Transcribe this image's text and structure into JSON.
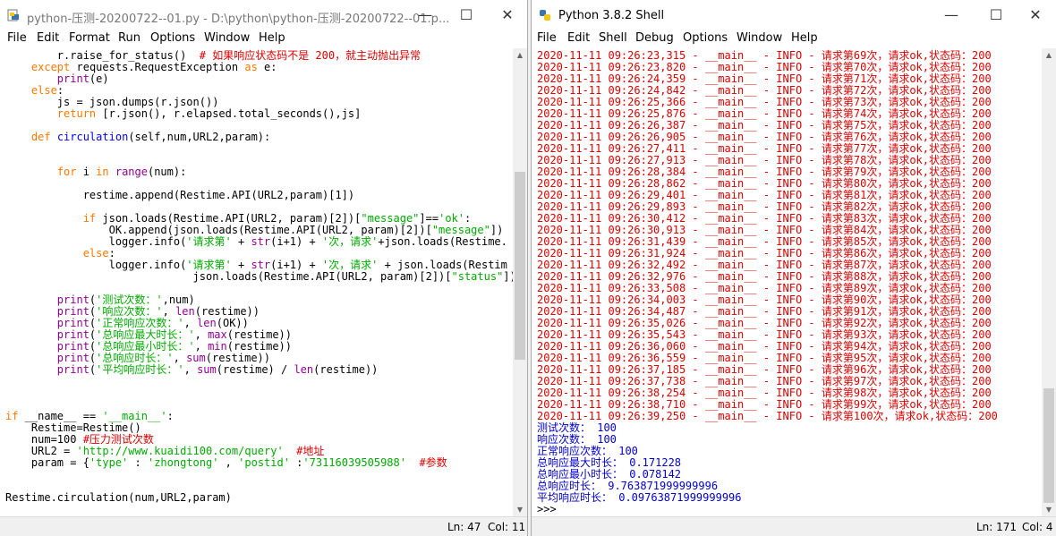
{
  "editor_window": {
    "title": "python-压测-20200722--01.py - D:\\python\\python-压测-20200722--01.p...",
    "menu": [
      "File",
      "Edit",
      "Format",
      "Run",
      "Options",
      "Window",
      "Help"
    ],
    "status": {
      "ln": "Ln: 47",
      "col": "Col: 11"
    },
    "code": [
      [
        {
          "t": "        r.raise_for_status()  ",
          "c": ""
        },
        {
          "t": "# 如果响应状态码不是 200，就主动抛出异常",
          "c": "cmt"
        }
      ],
      [
        {
          "t": "    ",
          "c": ""
        },
        {
          "t": "except",
          "c": "kw"
        },
        {
          "t": " requests.RequestException ",
          "c": ""
        },
        {
          "t": "as",
          "c": "kw"
        },
        {
          "t": " e:",
          "c": ""
        }
      ],
      [
        {
          "t": "        ",
          "c": ""
        },
        {
          "t": "print",
          "c": "bi"
        },
        {
          "t": "(e)",
          "c": ""
        }
      ],
      [
        {
          "t": "    ",
          "c": ""
        },
        {
          "t": "else",
          "c": "kw"
        },
        {
          "t": ":",
          "c": ""
        }
      ],
      [
        {
          "t": "        js = json.dumps(r.json())",
          "c": ""
        }
      ],
      [
        {
          "t": "        ",
          "c": ""
        },
        {
          "t": "return",
          "c": "kw"
        },
        {
          "t": " [r.json(), r.elapsed.total_seconds(),js]",
          "c": ""
        }
      ],
      [
        {
          "t": "",
          "c": ""
        }
      ],
      [
        {
          "t": "    ",
          "c": ""
        },
        {
          "t": "def",
          "c": "kw"
        },
        {
          "t": " ",
          "c": ""
        },
        {
          "t": "circulation",
          "c": "def"
        },
        {
          "t": "(self,num,URL2,param):",
          "c": ""
        }
      ],
      [
        {
          "t": "",
          "c": ""
        }
      ],
      [
        {
          "t": "",
          "c": ""
        }
      ],
      [
        {
          "t": "        ",
          "c": ""
        },
        {
          "t": "for",
          "c": "kw"
        },
        {
          "t": " i ",
          "c": ""
        },
        {
          "t": "in",
          "c": "kw"
        },
        {
          "t": " ",
          "c": ""
        },
        {
          "t": "range",
          "c": "bi"
        },
        {
          "t": "(num):",
          "c": ""
        }
      ],
      [
        {
          "t": "",
          "c": ""
        }
      ],
      [
        {
          "t": "            restime.append(Restime.API(URL2,param)[1])",
          "c": ""
        }
      ],
      [
        {
          "t": "",
          "c": ""
        }
      ],
      [
        {
          "t": "            ",
          "c": ""
        },
        {
          "t": "if",
          "c": "kw"
        },
        {
          "t": " json.loads(Restime.API(URL2, param)[2])[",
          "c": ""
        },
        {
          "t": "\"message\"",
          "c": "str"
        },
        {
          "t": "]==",
          "c": ""
        },
        {
          "t": "'ok'",
          "c": "str"
        },
        {
          "t": ":",
          "c": ""
        }
      ],
      [
        {
          "t": "                OK.append(json.loads(Restime.API(URL2, param)[2])[",
          "c": ""
        },
        {
          "t": "\"message\"",
          "c": "str"
        },
        {
          "t": "])",
          "c": ""
        }
      ],
      [
        {
          "t": "                logger.info(",
          "c": ""
        },
        {
          "t": "'请求第'",
          "c": "str"
        },
        {
          "t": " + ",
          "c": ""
        },
        {
          "t": "str",
          "c": "bi"
        },
        {
          "t": "(i+1) + ",
          "c": ""
        },
        {
          "t": "'次，请求'",
          "c": "str"
        },
        {
          "t": "+json.loads(Restime.",
          "c": ""
        }
      ],
      [
        {
          "t": "            ",
          "c": ""
        },
        {
          "t": "else",
          "c": "kw"
        },
        {
          "t": ":",
          "c": ""
        }
      ],
      [
        {
          "t": "                logger.info(",
          "c": ""
        },
        {
          "t": "'请求第'",
          "c": "str"
        },
        {
          "t": " + ",
          "c": ""
        },
        {
          "t": "str",
          "c": "bi"
        },
        {
          "t": "(i+1) + ",
          "c": ""
        },
        {
          "t": "'次，请求'",
          "c": "str"
        },
        {
          "t": " + json.loads(Restim",
          "c": ""
        }
      ],
      [
        {
          "t": "                             json.loads(Restime.API(URL2, param)[2])[",
          "c": ""
        },
        {
          "t": "\"status\"",
          "c": "str"
        },
        {
          "t": "])",
          "c": ""
        }
      ],
      [
        {
          "t": "",
          "c": ""
        }
      ],
      [
        {
          "t": "        ",
          "c": ""
        },
        {
          "t": "print",
          "c": "bi"
        },
        {
          "t": "(",
          "c": ""
        },
        {
          "t": "'测试次数：'",
          "c": "str"
        },
        {
          "t": ",num)",
          "c": ""
        }
      ],
      [
        {
          "t": "        ",
          "c": ""
        },
        {
          "t": "print",
          "c": "bi"
        },
        {
          "t": "(",
          "c": ""
        },
        {
          "t": "'响应次数：'",
          "c": "str"
        },
        {
          "t": ", ",
          "c": ""
        },
        {
          "t": "len",
          "c": "bi"
        },
        {
          "t": "(restime))",
          "c": ""
        }
      ],
      [
        {
          "t": "        ",
          "c": ""
        },
        {
          "t": "print",
          "c": "bi"
        },
        {
          "t": "(",
          "c": ""
        },
        {
          "t": "'正常响应次数：'",
          "c": "str"
        },
        {
          "t": ", ",
          "c": ""
        },
        {
          "t": "len",
          "c": "bi"
        },
        {
          "t": "(OK))",
          "c": ""
        }
      ],
      [
        {
          "t": "        ",
          "c": ""
        },
        {
          "t": "print",
          "c": "bi"
        },
        {
          "t": "(",
          "c": ""
        },
        {
          "t": "'总响应最大时长：'",
          "c": "str"
        },
        {
          "t": ", ",
          "c": ""
        },
        {
          "t": "max",
          "c": "bi"
        },
        {
          "t": "(restime))",
          "c": ""
        }
      ],
      [
        {
          "t": "        ",
          "c": ""
        },
        {
          "t": "print",
          "c": "bi"
        },
        {
          "t": "(",
          "c": ""
        },
        {
          "t": "'总响应最小时长：'",
          "c": "str"
        },
        {
          "t": ", ",
          "c": ""
        },
        {
          "t": "min",
          "c": "bi"
        },
        {
          "t": "(restime))",
          "c": ""
        }
      ],
      [
        {
          "t": "        ",
          "c": ""
        },
        {
          "t": "print",
          "c": "bi"
        },
        {
          "t": "(",
          "c": ""
        },
        {
          "t": "'总响应时长：'",
          "c": "str"
        },
        {
          "t": ", ",
          "c": ""
        },
        {
          "t": "sum",
          "c": "bi"
        },
        {
          "t": "(restime))",
          "c": ""
        }
      ],
      [
        {
          "t": "        ",
          "c": ""
        },
        {
          "t": "print",
          "c": "bi"
        },
        {
          "t": "(",
          "c": ""
        },
        {
          "t": "'平均响应时长：'",
          "c": "str"
        },
        {
          "t": ", ",
          "c": ""
        },
        {
          "t": "sum",
          "c": "bi"
        },
        {
          "t": "(restime) / ",
          "c": ""
        },
        {
          "t": "len",
          "c": "bi"
        },
        {
          "t": "(restime))",
          "c": ""
        }
      ],
      [
        {
          "t": "",
          "c": ""
        }
      ],
      [
        {
          "t": "",
          "c": ""
        }
      ],
      [
        {
          "t": "",
          "c": ""
        }
      ],
      [
        {
          "t": "if",
          "c": "kw"
        },
        {
          "t": " __name__ == ",
          "c": ""
        },
        {
          "t": "'__main__'",
          "c": "str"
        },
        {
          "t": ":",
          "c": ""
        }
      ],
      [
        {
          "t": "    Restime=Restime()",
          "c": ""
        }
      ],
      [
        {
          "t": "    num=100 ",
          "c": ""
        },
        {
          "t": "#压力测试次数",
          "c": "cmt"
        }
      ],
      [
        {
          "t": "    URL2 = ",
          "c": ""
        },
        {
          "t": "'http://www.kuaidi100.com/query'",
          "c": "str"
        },
        {
          "t": "  ",
          "c": ""
        },
        {
          "t": "#地址",
          "c": "cmt"
        }
      ],
      [
        {
          "t": "    param = {",
          "c": ""
        },
        {
          "t": "'type'",
          "c": "str"
        },
        {
          "t": " : ",
          "c": ""
        },
        {
          "t": "'zhongtong'",
          "c": "str"
        },
        {
          "t": " , ",
          "c": ""
        },
        {
          "t": "'postid'",
          "c": "str"
        },
        {
          "t": " :",
          "c": ""
        },
        {
          "t": "'73116039505988'",
          "c": "str"
        },
        {
          "t": "  ",
          "c": ""
        },
        {
          "t": "#参数",
          "c": "cmt"
        }
      ],
      [
        {
          "t": "",
          "c": ""
        }
      ],
      [
        {
          "t": "",
          "c": ""
        }
      ],
      [
        {
          "t": "Restime.circulation(num,URL2,param)",
          "c": ""
        }
      ]
    ]
  },
  "shell_window": {
    "title": "Python 3.8.2 Shell",
    "menu": [
      "File",
      "Edit",
      "Shell",
      "Debug",
      "Options",
      "Window",
      "Help"
    ],
    "status": {
      "ln": "Ln: 171",
      "col": "Col: 4"
    },
    "log_lines": [
      "2020-11-11 09:26:23,315 - __main__ - INFO - 请求第69次，请求ok,状态码：200",
      "2020-11-11 09:26:23,820 - __main__ - INFO - 请求第70次，请求ok,状态码：200",
      "2020-11-11 09:26:24,359 - __main__ - INFO - 请求第71次，请求ok,状态码：200",
      "2020-11-11 09:26:24,842 - __main__ - INFO - 请求第72次，请求ok,状态码：200",
      "2020-11-11 09:26:25,366 - __main__ - INFO - 请求第73次，请求ok,状态码：200",
      "2020-11-11 09:26:25,876 - __main__ - INFO - 请求第74次，请求ok,状态码：200",
      "2020-11-11 09:26:26,387 - __main__ - INFO - 请求第75次，请求ok,状态码：200",
      "2020-11-11 09:26:26,905 - __main__ - INFO - 请求第76次，请求ok,状态码：200",
      "2020-11-11 09:26:27,411 - __main__ - INFO - 请求第77次，请求ok,状态码：200",
      "2020-11-11 09:26:27,913 - __main__ - INFO - 请求第78次，请求ok,状态码：200",
      "2020-11-11 09:26:28,384 - __main__ - INFO - 请求第79次，请求ok,状态码：200",
      "2020-11-11 09:26:28,862 - __main__ - INFO - 请求第80次，请求ok,状态码：200",
      "2020-11-11 09:26:29,401 - __main__ - INFO - 请求第81次，请求ok,状态码：200",
      "2020-11-11 09:26:29,893 - __main__ - INFO - 请求第82次，请求ok,状态码：200",
      "2020-11-11 09:26:30,412 - __main__ - INFO - 请求第83次，请求ok,状态码：200",
      "2020-11-11 09:26:30,913 - __main__ - INFO - 请求第84次，请求ok,状态码：200",
      "2020-11-11 09:26:31,439 - __main__ - INFO - 请求第85次，请求ok,状态码：200",
      "2020-11-11 09:26:31,924 - __main__ - INFO - 请求第86次，请求ok,状态码：200",
      "2020-11-11 09:26:32,492 - __main__ - INFO - 请求第87次，请求ok,状态码：200",
      "2020-11-11 09:26:32,976 - __main__ - INFO - 请求第88次，请求ok,状态码：200",
      "2020-11-11 09:26:33,508 - __main__ - INFO - 请求第89次，请求ok,状态码：200",
      "2020-11-11 09:26:34,003 - __main__ - INFO - 请求第90次，请求ok,状态码：200",
      "2020-11-11 09:26:34,487 - __main__ - INFO - 请求第91次，请求ok,状态码：200",
      "2020-11-11 09:26:35,026 - __main__ - INFO - 请求第92次，请求ok,状态码：200",
      "2020-11-11 09:26:35,543 - __main__ - INFO - 请求第93次，请求ok,状态码：200",
      "2020-11-11 09:26:36,060 - __main__ - INFO - 请求第94次，请求ok,状态码：200",
      "2020-11-11 09:26:36,559 - __main__ - INFO - 请求第95次，请求ok,状态码：200",
      "2020-11-11 09:26:37,185 - __main__ - INFO - 请求第96次，请求ok,状态码：200",
      "2020-11-11 09:26:37,738 - __main__ - INFO - 请求第97次，请求ok,状态码：200",
      "2020-11-11 09:26:38,254 - __main__ - INFO - 请求第98次，请求ok,状态码：200",
      "2020-11-11 09:26:38,710 - __main__ - INFO - 请求第99次，请求ok,状态码：200",
      "2020-11-11 09:26:39,250 - __main__ - INFO - 请求第100次，请求ok,状态码：200"
    ],
    "result_lines": [
      "测试次数： 100",
      "响应次数： 100",
      "正常响应次数： 100",
      "总响应最大时长： 0.171228",
      "总响应最小时长： 0.078142",
      "总响应时长： 9.763871999999996",
      "平均响应时长： 0.09763871999999996"
    ],
    "prompt": ">>>"
  },
  "controls": {
    "minimize": "—",
    "maximize": "☐",
    "close": "✕"
  },
  "colors": {
    "log_text": "#dd0000",
    "result_text": "#0000cc",
    "keyword": "#ff7700",
    "string": "#00aa00",
    "builtin": "#900090"
  }
}
